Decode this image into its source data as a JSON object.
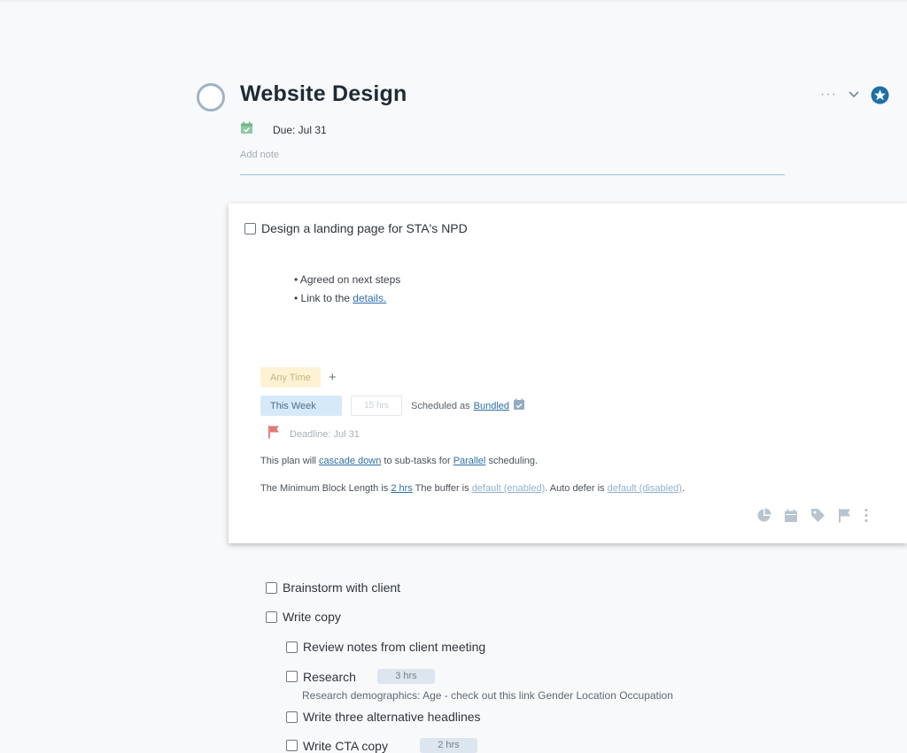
{
  "header": {
    "title": "Website Design",
    "due": "Due: Jul 31",
    "add_note_placeholder": "Add note",
    "more_icon": "ellipsis-icon",
    "collapse_icon": "chevron-down-icon",
    "star_icon": "star-icon"
  },
  "card": {
    "task": "Design a landing page for STA's NPD",
    "bullets": [
      {
        "text": "Agreed on next steps",
        "link": ""
      },
      {
        "text": "Link to the ",
        "link": "details."
      }
    ],
    "time_pill": "Any Time",
    "add_label": "+",
    "week_pill": "This Week",
    "hours_placeholder": "15 hrs",
    "scheduled_prefix": "Scheduled as",
    "scheduled_link": "Bundled",
    "deadline": "Deadline: Jul 31",
    "plan_prefix": "This plan will",
    "plan_link1": "cascade down",
    "plan_mid": "to sub-tasks for",
    "plan_link2": "Parallel",
    "plan_suffix": "scheduling.",
    "minblock_prefix": "The Minimum Block Length is",
    "minblock_link": "2 hrs",
    "buffer_prefix": "The buffer is",
    "buffer_link": "default (enabled)",
    "autodefer_prefix": ". Auto defer is",
    "autodefer_link": "default (disabled)",
    "autodefer_suffix": ".",
    "tool_icons": [
      "pie-chart-icon",
      "calendar-icon",
      "tag-icon",
      "flag-icon",
      "vertical-ellipsis-icon"
    ]
  },
  "subtasks": [
    {
      "label": "Brainstorm with client"
    },
    {
      "label": "Write copy"
    },
    {
      "label": "Review notes from client meeting"
    },
    {
      "label": "Research",
      "hours": "3 hrs",
      "note": "Research demographics: Age - check out this link Gender Location Occupation"
    },
    {
      "label": "Write three alternative headlines"
    },
    {
      "label": "Write CTA copy",
      "hours": "2 hrs"
    }
  ],
  "colors": {
    "accent": "#2d6fa8",
    "star": "#1d6fa5",
    "deadline_flag": "#e07a7a",
    "calendar_green": "#8dc9a3"
  }
}
